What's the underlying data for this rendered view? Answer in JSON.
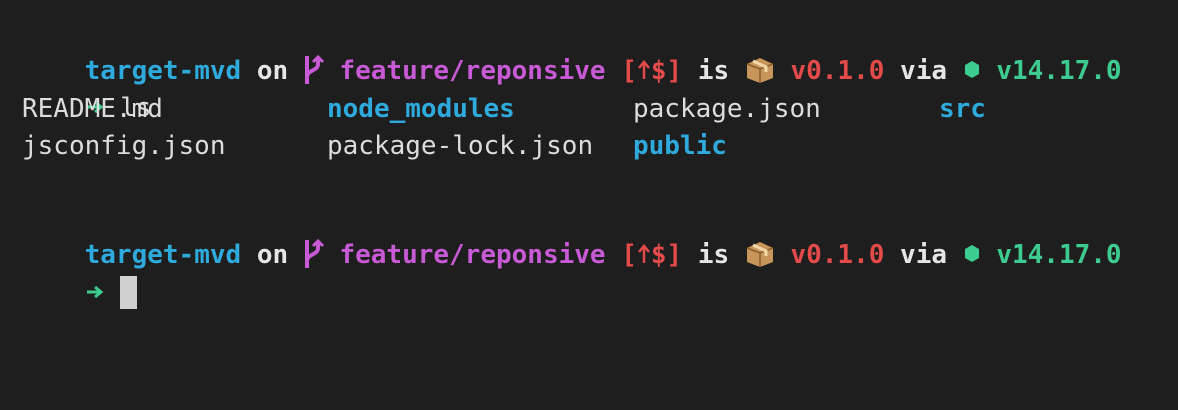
{
  "prompt": {
    "directory": "target-mvd",
    "on": "on",
    "branch": "feature/reponsive",
    "status_open": "[",
    "status_close": "$]",
    "is": "is",
    "version": "v0.1.0",
    "via": "via",
    "node_version": "v14.17.0"
  },
  "command": "ls",
  "listing": {
    "row1": [
      "README.md",
      "node_modules",
      "package.json",
      "src"
    ],
    "row2": [
      "jsconfig.json",
      "package-lock.json",
      "public"
    ]
  },
  "icons": {
    "branch": "git-branch-icon",
    "package": "package-box-icon",
    "node": "nodejs-hexagon-icon",
    "arrow": "prompt-arrow-icon",
    "ahead": "up-arrow-icon"
  },
  "colors": {
    "background": "#1e1e1e",
    "directory": "#2eaadc",
    "branch": "#c95ad6",
    "status": "#e34b4b",
    "version": "#e34b4b",
    "node": "#3ecb8f",
    "arrow": "#3ecb8f",
    "text": "#dcdcdc"
  }
}
